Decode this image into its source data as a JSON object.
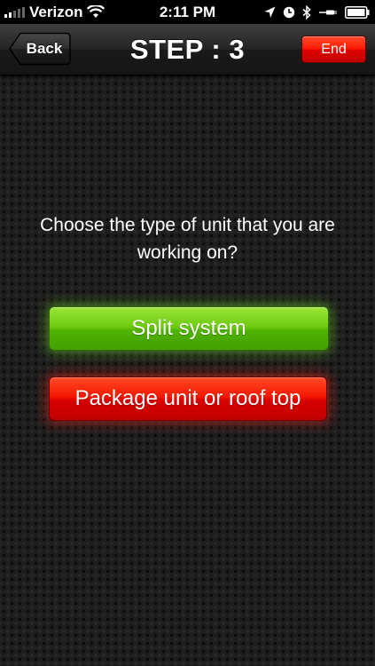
{
  "status_bar": {
    "carrier": "Verizon",
    "time": "2:11 PM",
    "icons": [
      "signal-icon",
      "wifi-icon",
      "location-icon",
      "alarm-icon",
      "bluetooth-icon",
      "battery-icon"
    ]
  },
  "nav": {
    "back_label": "Back",
    "title": "STEP : 3",
    "end_label": "End"
  },
  "content": {
    "question": "Choose the type of unit that you are working on?",
    "options": [
      {
        "label": "Split system",
        "color": "#5ec000"
      },
      {
        "label": "Package unit or roof top",
        "color": "#e80000"
      }
    ]
  },
  "colors": {
    "background": "#1e1e1e",
    "end_button": "#e80000"
  }
}
